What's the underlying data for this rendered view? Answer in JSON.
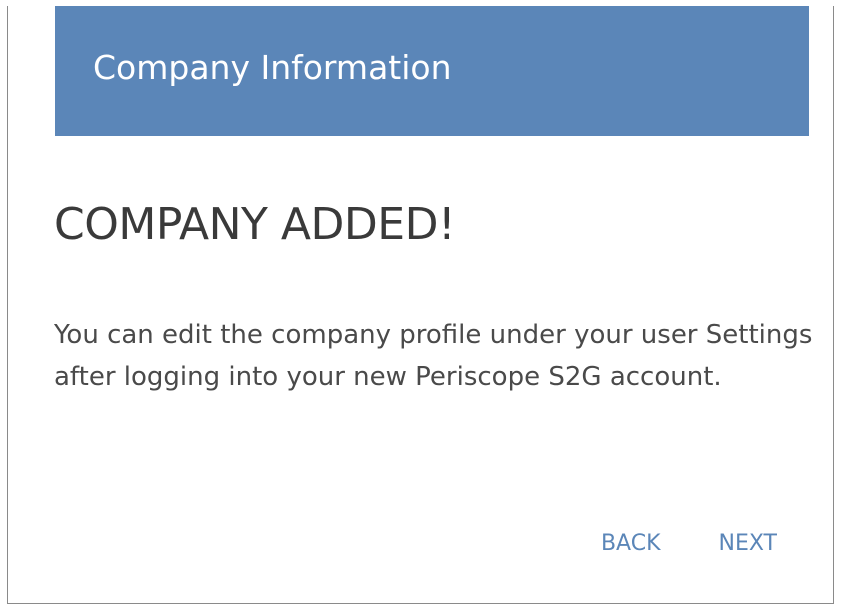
{
  "header": {
    "title": "Company Information"
  },
  "main": {
    "headline": "COMPANY ADDED!",
    "message": "You can edit the company profile under your user Settings after logging into your new Periscope S2G account."
  },
  "actions": {
    "back_label": "BACK",
    "next_label": "NEXT"
  },
  "colors": {
    "header_bg": "#5b86b8",
    "link": "#5b86b8",
    "headline_text": "#3a3a3a",
    "body_text": "#4a4a4a"
  }
}
